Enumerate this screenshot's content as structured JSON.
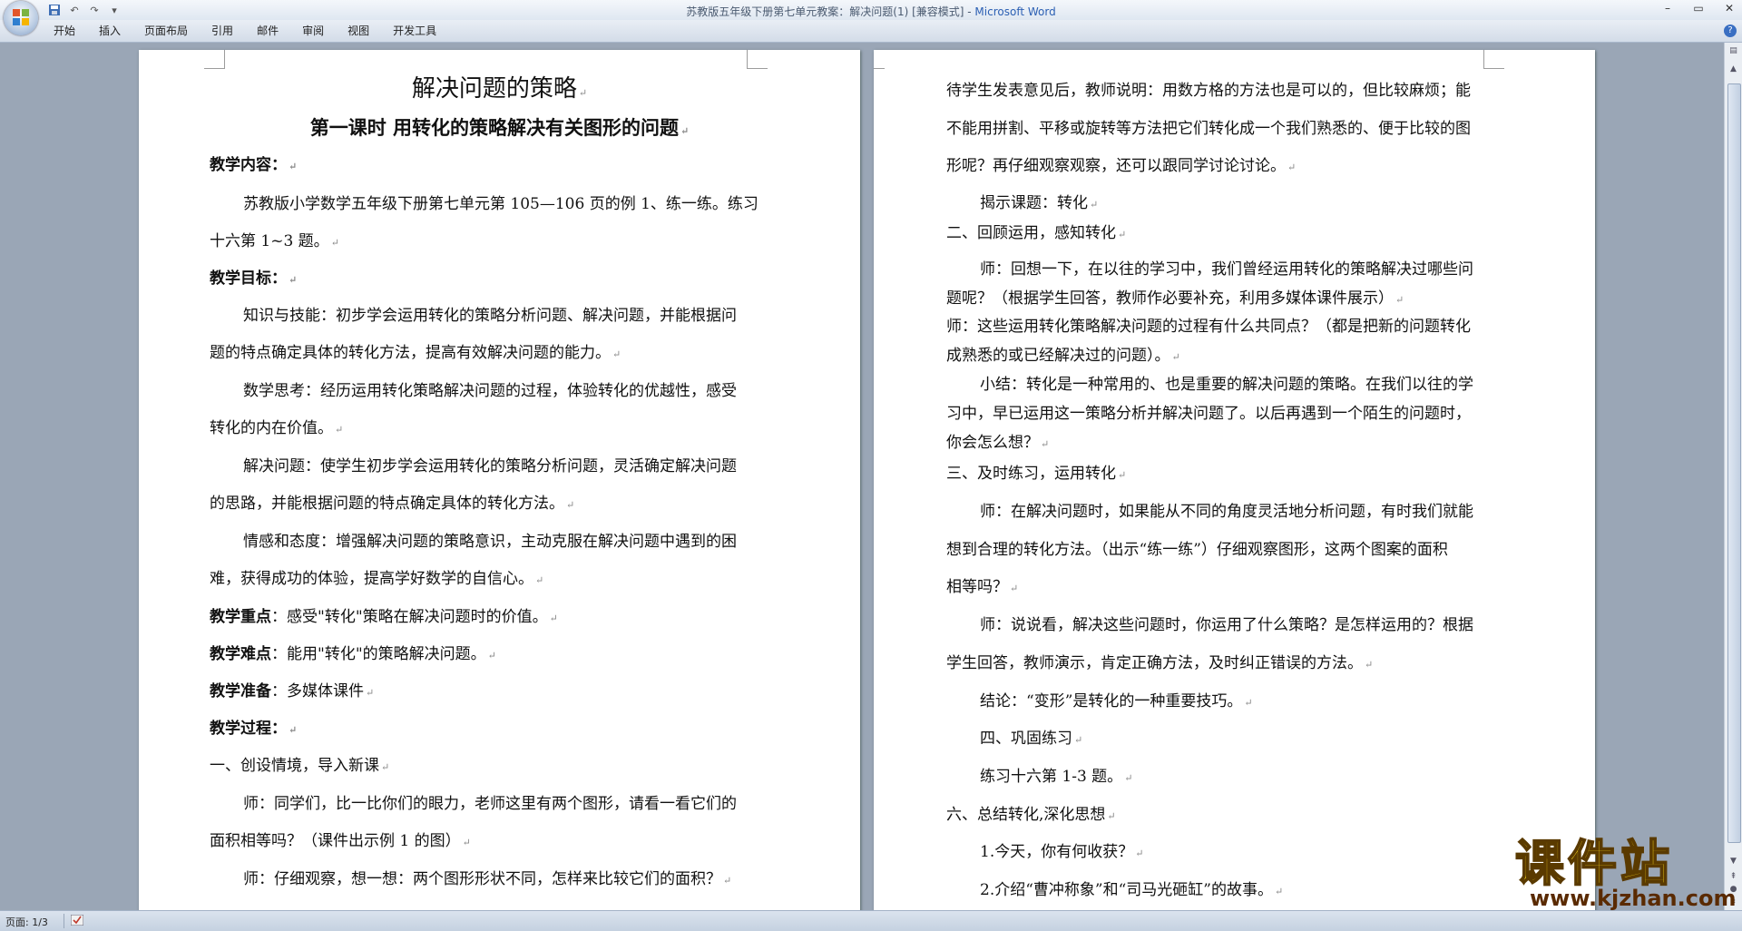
{
  "window": {
    "title_doc": "苏教版五年级下册第七单元教案：解决问题(1) [兼容模式] - ",
    "title_app": "Microsoft Word"
  },
  "quick_access": {
    "undo_label": "↶",
    "redo_label": "↷",
    "more_label": "▾"
  },
  "ribbon_tabs": [
    "开始",
    "插入",
    "页面布局",
    "引用",
    "邮件",
    "审阅",
    "视图",
    "开发工具"
  ],
  "help_label": "?",
  "pilcrow": "↵",
  "left_page": {
    "title": "解决问题的策略",
    "subtitle": "第一课时  用转化的策略解决有关图形的问题",
    "content_heading": "教学内容：",
    "content_l1": "苏教版小学数学五年级下册第七单元第 105—106 页的例 1、练一练。练习",
    "content_l2": "十六第 1~3 题。",
    "goals_heading": "教学目标：",
    "goal1_l1": "知识与技能：初步学会运用转化的策略分析问题、解决问题，并能根据问",
    "goal1_l2": "题的特点确定具体的转化方法，提高有效解决问题的能力。",
    "goal2_l1": "数学思考：经历运用转化策略解决问题的过程，体验转化的优越性，感受",
    "goal2_l2": "转化的内在价值。",
    "goal3_l1": "解决问题：使学生初步学会运用转化的策略分析问题，灵活确定解决问题",
    "goal3_l2": "的思路，并能根据问题的特点确定具体的转化方法。",
    "goal4_l1": "情感和态度：增强解决问题的策略意识，主动克服在解决问题中遇到的困",
    "goal4_l2": "难，获得成功的体验，提高学好数学的自信心。",
    "key_label": "教学重点",
    "key_text": "：感受\"转化\"策略在解决问题时的价值。",
    "diff_label": "教学难点",
    "diff_text": "：能用\"转化\"的策略解决问题。",
    "prep_label": "教学准备",
    "prep_text": "：多媒体课件",
    "process_heading": "教学过程：",
    "sec1": "一、创设情境，导入新课",
    "teacher1_l1": "师：同学们，比一比你们的眼力，老师这里有两个图形，请看一看它们的",
    "teacher1_l2": "面积相等吗？（课件出示例 1 的图）",
    "teacher2": "师：仔细观察，想一想：两个图形形状不同，怎样来比较它们的面积？"
  },
  "right_page": {
    "p1_l1": "待学生发表意见后，教师说明：用数方格的方法也是可以的，但比较麻烦；能",
    "p1_l2": "不能用拼割、平移或旋转等方法把它们转化成一个我们熟悉的、便于比较的图",
    "p1_l3": "形呢？再仔细观察观察，还可以跟同学讨论讨论。",
    "reveal": "揭示课题：转化",
    "sec2": "二、回顾运用，感知转化",
    "t1_l1": "师：回想一下，在以往的学习中，我们曾经运用转化的策略解决过哪些问",
    "t1_l2": "题呢？（根据学生回答，教师作必要补充，利用多媒体课件展示）",
    "t2_l1": "师：这些运用转化策略解决问题的过程有什么共同点？（都是把新的问题转化",
    "t2_l2": "成熟悉的或已经解决过的问题）。",
    "sum_l1": "小结：转化是一种常用的、也是重要的解决问题的策略。在我们以往的学",
    "sum_l2": "习中，早已运用这一策略分析并解决问题了。以后再遇到一个陌生的问题时，",
    "sum_l3": "你会怎么想？",
    "sec3": "三、及时练习，运用转化",
    "t3_l1": "师：在解决问题时，如果能从不同的角度灵活地分析问题，有时我们就能",
    "t3_l2": "想到合理的转化方法。（出示“练一练”）仔细观察图形，这两个图案的面积",
    "t3_l3": "相等吗？",
    "t4_l1": "师：说说看，解决这些问题时，你运用了什么策略？是怎样运用的？根据",
    "t4_l2": "学生回答，教师演示，肯定正确方法，及时纠正错误的方法。",
    "conclusion": "结论：“变形”是转化的一种重要技巧。",
    "sec4": "四、巩固练习",
    "exercise": "练习十六第 1-3 题。",
    "sec6": "六、总结转化,深化思想",
    "q1": "1.今天，你有何收获？",
    "q2": "2.介绍“曹冲称象”和“司马光砸缸”的故事。"
  },
  "status": {
    "page": "页面: 1/3"
  },
  "watermark": {
    "main": "课件站",
    "url": "www.kjzhan.com"
  },
  "colors": {
    "workspace": "#9aa6b6",
    "ribbon": "#d3dce8",
    "watermark_yellow": "#f4d21c"
  }
}
